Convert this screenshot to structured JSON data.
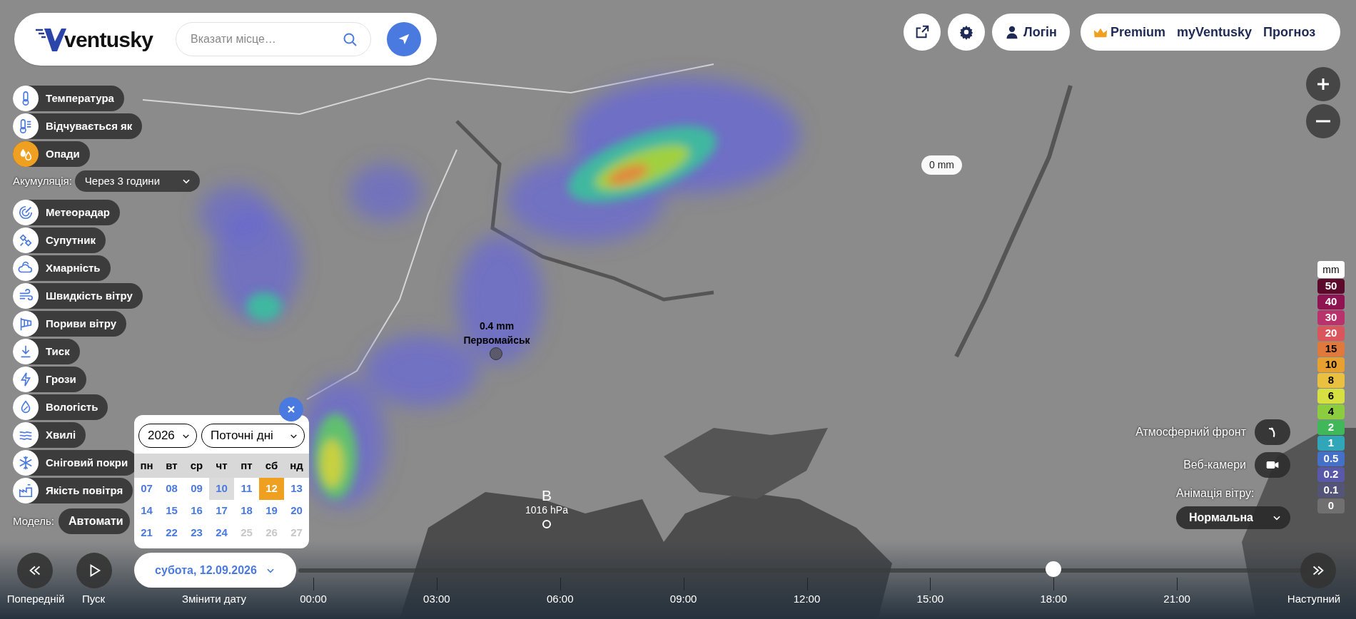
{
  "header": {
    "logo": "ventusky",
    "search": {
      "placeholder": "Вказати місце…"
    }
  },
  "top_bar": {
    "login": "Логін",
    "premium": "Premium",
    "links": [
      "myVentusky",
      "Прогноз"
    ]
  },
  "layers": [
    {
      "label": "Температура",
      "selected": false
    },
    {
      "label": "Відчувається як",
      "selected": false
    },
    {
      "label": "Опади",
      "selected": true
    },
    {
      "label": "Метеорадар",
      "selected": false
    },
    {
      "label": "Супутник",
      "selected": false
    },
    {
      "label": "Хмарність",
      "selected": false
    },
    {
      "label": "Швидкість вітру",
      "selected": false
    },
    {
      "label": "Пориви вітру",
      "selected": false
    },
    {
      "label": "Тиск",
      "selected": false
    },
    {
      "label": "Грози",
      "selected": false
    },
    {
      "label": "Вологість",
      "selected": false
    },
    {
      "label": "Хвилі",
      "selected": false
    },
    {
      "label": "Сніговий покри",
      "selected": false
    },
    {
      "label": "Якість повітря",
      "selected": false
    }
  ],
  "accumulation": {
    "label": "Акумуляція:",
    "value": "Через 3 години"
  },
  "model": {
    "label": "Модель:",
    "value": "Автомати"
  },
  "map_overlays": {
    "point": {
      "value": "0.4 mm",
      "place": "Первомайськ"
    },
    "cursor_value": "0 mm",
    "pressure": {
      "letter": "B",
      "value": "1016 hPa"
    }
  },
  "legend": {
    "unit": "mm",
    "items": [
      {
        "label": "50",
        "color": "#5c0a2c"
      },
      {
        "label": "40",
        "color": "#8e1452"
      },
      {
        "label": "30",
        "color": "#b8336c"
      },
      {
        "label": "20",
        "color": "#d9575c"
      },
      {
        "label": "15",
        "color": "#e07a3c"
      },
      {
        "label": "10",
        "color": "#e8a030"
      },
      {
        "label": "8",
        "color": "#eac040"
      },
      {
        "label": "6",
        "color": "#d6e040"
      },
      {
        "label": "4",
        "color": "#8ccd40"
      },
      {
        "label": "2",
        "color": "#40b85a"
      },
      {
        "label": "1",
        "color": "#30a6b8"
      },
      {
        "label": "0.5",
        "color": "#4470c8"
      },
      {
        "label": "0.2",
        "color": "#5a58a8"
      },
      {
        "label": "0.1",
        "color": "#545478"
      },
      {
        "label": "0",
        "color": "#707070"
      }
    ]
  },
  "right_controls": {
    "front": "Атмосферний фронт",
    "webcams": "Веб-камери",
    "wind_animation": {
      "label": "Анімація вітру:",
      "value": "Нормальна"
    }
  },
  "calendar": {
    "year": "2026",
    "range": "Поточні дні",
    "weekdays": [
      "пн",
      "вт",
      "ср",
      "чт",
      "пт",
      "сб",
      "нд"
    ],
    "days": [
      {
        "label": "07",
        "selected": false,
        "today": false,
        "disabled": false
      },
      {
        "label": "08",
        "selected": false,
        "today": false,
        "disabled": false
      },
      {
        "label": "09",
        "selected": false,
        "today": false,
        "disabled": false
      },
      {
        "label": "10",
        "selected": false,
        "today": true,
        "disabled": false
      },
      {
        "label": "11",
        "selected": false,
        "today": false,
        "disabled": false
      },
      {
        "label": "12",
        "selected": true,
        "today": false,
        "disabled": false
      },
      {
        "label": "13",
        "selected": false,
        "today": false,
        "disabled": false
      },
      {
        "label": "14",
        "selected": false,
        "today": false,
        "disabled": false
      },
      {
        "label": "15",
        "selected": false,
        "today": false,
        "disabled": false
      },
      {
        "label": "16",
        "selected": false,
        "today": false,
        "disabled": false
      },
      {
        "label": "17",
        "selected": false,
        "today": false,
        "disabled": false
      },
      {
        "label": "18",
        "selected": false,
        "today": false,
        "disabled": false
      },
      {
        "label": "19",
        "selected": false,
        "today": false,
        "disabled": false
      },
      {
        "label": "20",
        "selected": false,
        "today": false,
        "disabled": false
      },
      {
        "label": "21",
        "selected": false,
        "today": false,
        "disabled": false
      },
      {
        "label": "22",
        "selected": false,
        "today": false,
        "disabled": false
      },
      {
        "label": "23",
        "selected": false,
        "today": false,
        "disabled": false
      },
      {
        "label": "24",
        "selected": false,
        "today": false,
        "disabled": false
      },
      {
        "label": "25",
        "selected": false,
        "today": false,
        "disabled": true
      },
      {
        "label": "26",
        "selected": false,
        "today": false,
        "disabled": true
      },
      {
        "label": "27",
        "selected": false,
        "today": false,
        "disabled": true
      }
    ]
  },
  "date_button": "субота, 12.09.2026",
  "timeline": {
    "prev": "Попередній",
    "play": "Пуск",
    "change_date": "Змінити дату",
    "next": "Наступний",
    "times": [
      "00:00",
      "03:00",
      "06:00",
      "09:00",
      "12:00",
      "15:00",
      "18:00",
      "21:00"
    ],
    "level": 0.75
  }
}
